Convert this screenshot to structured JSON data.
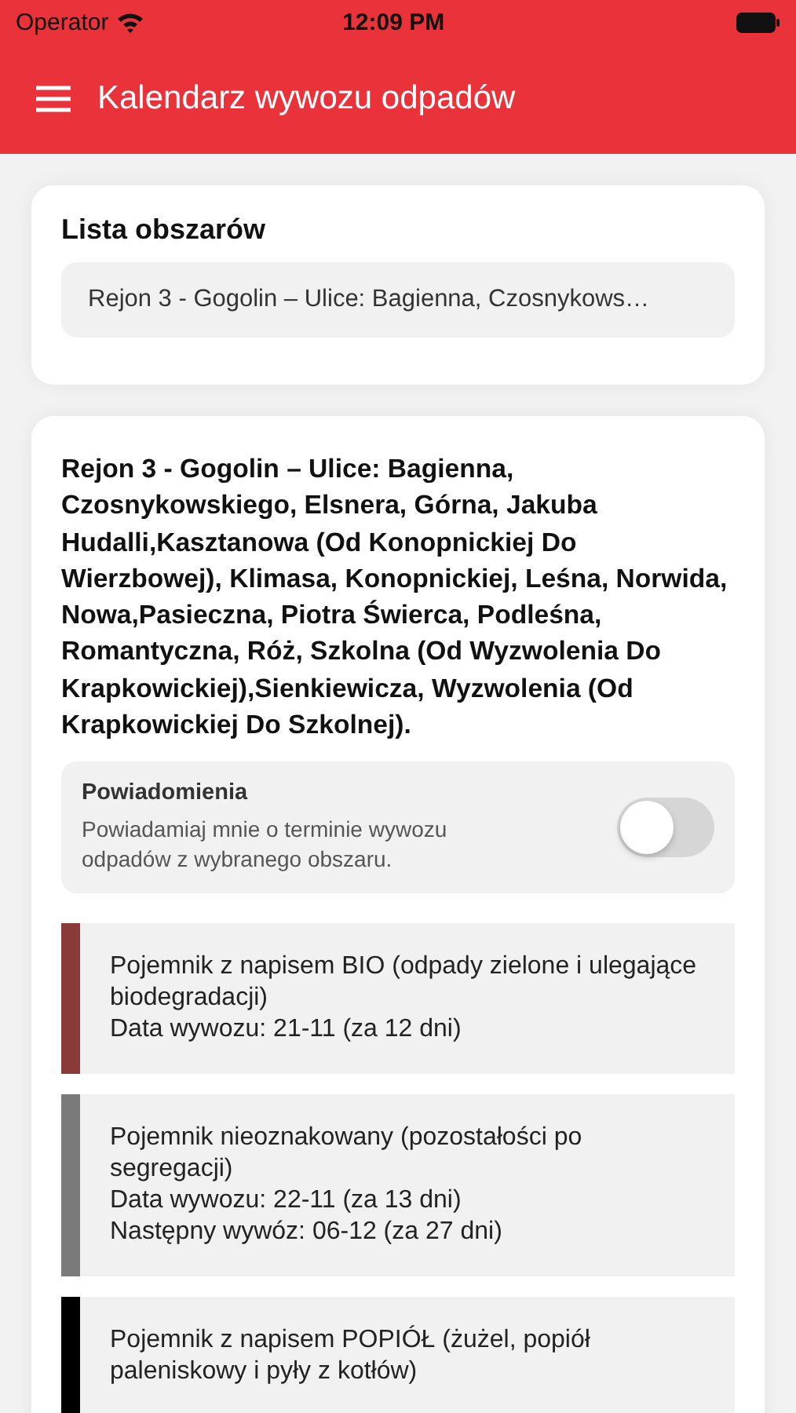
{
  "status_bar": {
    "carrier": "Operator",
    "time": "12:09 PM"
  },
  "header": {
    "title": "Kalendarz wywozu odpadów"
  },
  "area_list": {
    "title": "Lista obszarów",
    "selected_value": "Rejon 3 - Gogolin – Ulice: Bagienna, Czosnykows…"
  },
  "area": {
    "title": "Rejon 3 - Gogolin – Ulice: Bagienna, Czosnykowskiego, Elsnera, Górna, Jakuba Hudalli,Kasztanowa (Od Konopnickiej Do Wierzbowej), Klimasa, Konopnickiej, Leśna, Norwida, Nowa,Pasieczna, Piotra Świerca, Podleśna, Romantyczna, Róż, Szkolna (Od Wyzwolenia Do Krapkowickiej),Sienkiewicza, Wyzwolenia (Od Krapkowickiej Do Szkolnej).",
    "notifications": {
      "title": "Powiadomienia",
      "description": "Powiadamiaj mnie o terminie wywozu odpadów z wybranego obszaru.",
      "on": false
    },
    "bins": [
      {
        "color": "#8b3a3a",
        "lines": [
          "Pojemnik z napisem BIO (odpady zielone i ulegające biodegradacji)",
          "Data wywozu: 21-11 (za 12 dni)"
        ]
      },
      {
        "color": "#7a7a7a",
        "lines": [
          "Pojemnik nieoznakowany (pozostałości po segregacji)",
          "Data wywozu: 22-11 (za 13 dni)",
          "Następny wywóz: 06-12 (za 27 dni)"
        ]
      },
      {
        "color": "#000000",
        "lines": [
          "Pojemnik z napisem POPIÓŁ (żużel, popiół paleniskowy i pyły z kotłów)"
        ]
      }
    ]
  }
}
